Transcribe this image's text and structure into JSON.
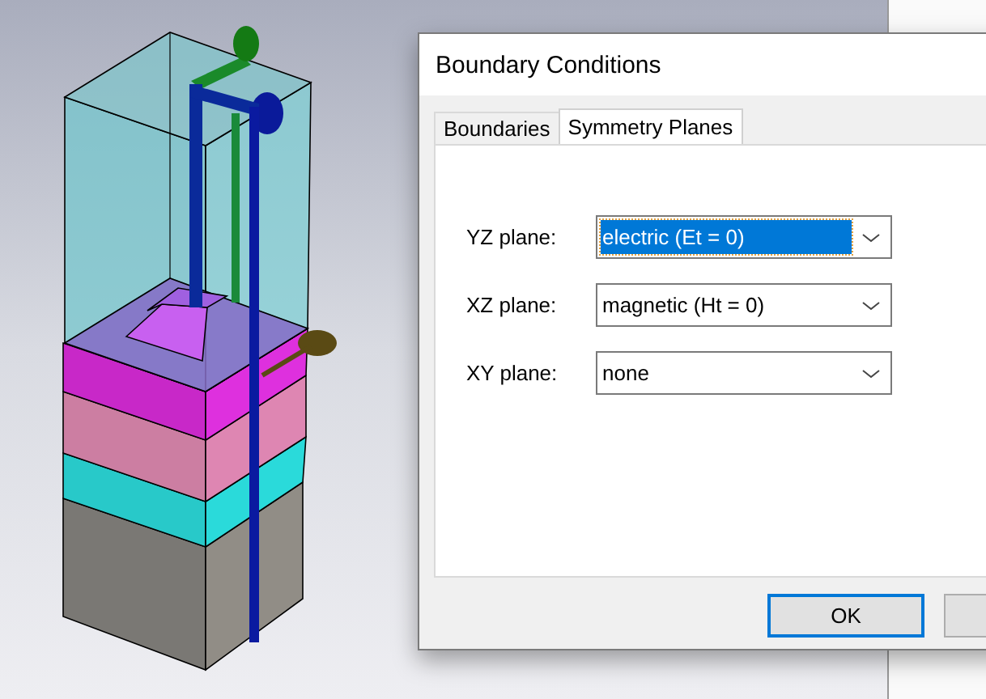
{
  "dialog": {
    "title": "Boundary Conditions",
    "tabs": [
      {
        "label": "Boundaries",
        "selected": false
      },
      {
        "label": "Symmetry Planes",
        "selected": true
      }
    ],
    "planes": [
      {
        "label": "YZ plane:",
        "value": "electric (Et = 0)",
        "focused": true
      },
      {
        "label": "XZ plane:",
        "value": "magnetic (Ht = 0)",
        "focused": false
      },
      {
        "label": "XY plane:",
        "value": "none",
        "focused": false
      }
    ],
    "buttons": [
      {
        "label": "OK",
        "default": true
      }
    ]
  }
}
